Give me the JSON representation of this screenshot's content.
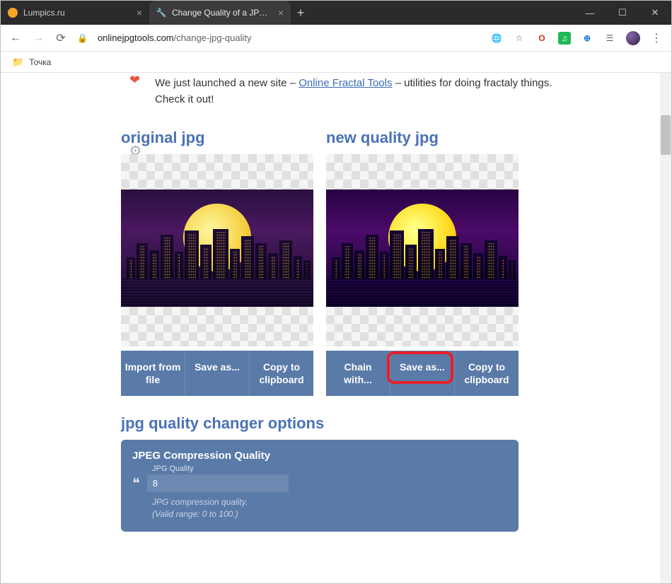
{
  "window": {
    "tabs": [
      {
        "title": "Lumpics.ru"
      },
      {
        "title": "Change Quality of a JPEG - Onlin"
      }
    ]
  },
  "addressbar": {
    "domain": "onlinejpgtools.com",
    "path": "/change-jpg-quality"
  },
  "bookmarks": {
    "item1": "Точка"
  },
  "banner": {
    "prefix": "We just launched a new site – ",
    "link": "Online Fractal Tools",
    "suffix": " – utilities for doing fractaly things. Check it out!"
  },
  "panels": {
    "original": {
      "title": "original jpg",
      "buttons": {
        "import": "Import from file",
        "save": "Save as...",
        "copy": "Copy to clipboard"
      }
    },
    "result": {
      "title": "new quality jpg",
      "buttons": {
        "chain": "Chain with...",
        "save": "Save as...",
        "copy": "Copy to clipboard"
      }
    }
  },
  "options": {
    "title": "jpg quality changer options",
    "heading": "JPEG Compression Quality",
    "label": "JPG Quality",
    "value": "8",
    "hint1": "JPG compression quality.",
    "hint2": "(Valid range: 0 to 100.)"
  }
}
